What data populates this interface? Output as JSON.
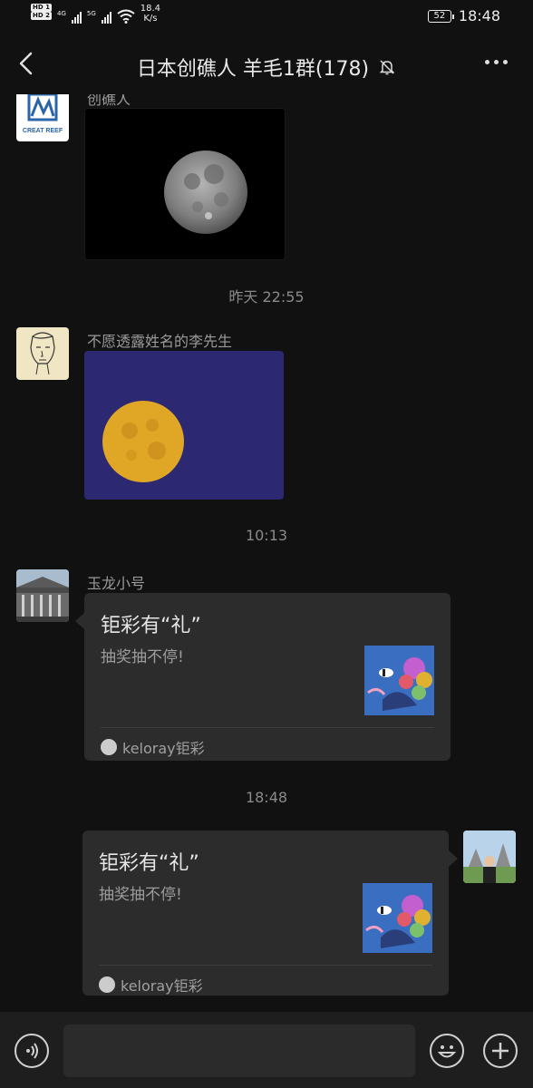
{
  "status_bar": {
    "hd1": "HD 1",
    "hd2": "HD 2",
    "net1": "4G",
    "net2": "5G",
    "speed_value": "18.4",
    "speed_unit": "K/s",
    "battery": "52",
    "time": "18:48"
  },
  "header": {
    "title": "日本创礁人 羊毛1群(178)"
  },
  "messages": {
    "partial_sender": "创礁人",
    "partial_avatar_text": "CREAT REEF",
    "ts1": "昨天 22:55",
    "sender2": "不愿透露姓名的李先生",
    "ts2": "10:13",
    "sender3": "玉龙小号",
    "card1": {
      "title": "钜彩有“礼”",
      "desc": "抽奖抽不停!",
      "source": "keloray钜彩"
    },
    "ts3": "18:48",
    "card2": {
      "title": "钜彩有“礼”",
      "desc": "抽奖抽不停!",
      "source": "keloray钜彩"
    }
  },
  "colors": {
    "background": "#111111",
    "bubble": "#2c2c2c",
    "moon2_bg": "#2d2872",
    "moon2_color": "#e0a625"
  }
}
